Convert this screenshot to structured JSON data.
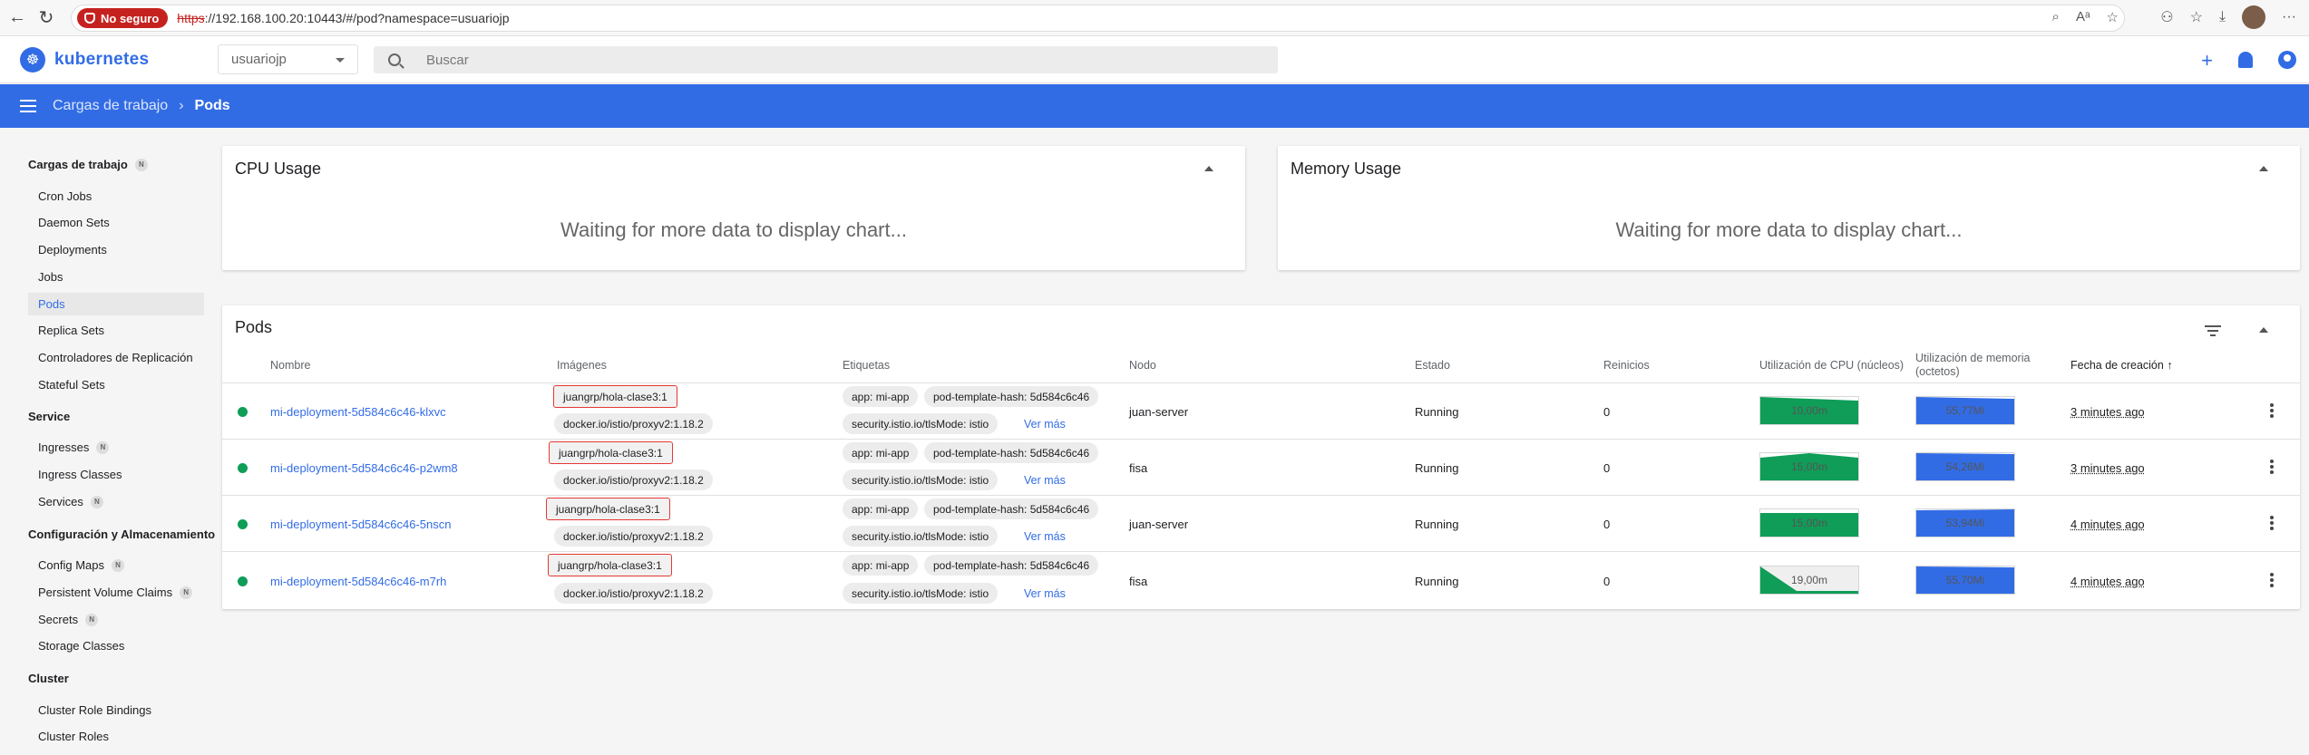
{
  "browser": {
    "insecure_label": "No seguro",
    "url_proto": "https",
    "url_rest": "://192.168.100.20:10443/#/pod?namespace=usuariojp"
  },
  "header": {
    "logo_text": "kubernetes",
    "namespace": "usuariojp",
    "search_placeholder": "Buscar"
  },
  "toolbar": {
    "crumb_parent": "Cargas de trabajo",
    "crumb_current": "Pods"
  },
  "sidebar": {
    "sections": [
      {
        "label": "Cargas de trabajo",
        "badge": "N"
      },
      {
        "label": "Service"
      },
      {
        "label": "Configuración y Almacenamiento"
      },
      {
        "label": "Cluster"
      }
    ],
    "items": [
      {
        "label": "Cron Jobs"
      },
      {
        "label": "Daemon Sets"
      },
      {
        "label": "Deployments"
      },
      {
        "label": "Jobs"
      },
      {
        "label": "Pods",
        "active": true
      },
      {
        "label": "Replica Sets"
      },
      {
        "label": "Controladores de Replicación"
      },
      {
        "label": "Stateful Sets"
      },
      {
        "label": "Ingresses",
        "badge": "N"
      },
      {
        "label": "Ingress Classes"
      },
      {
        "label": "Services",
        "badge": "N"
      },
      {
        "label": "Config Maps",
        "badge": "N"
      },
      {
        "label": "Persistent Volume Claims",
        "badge": "N"
      },
      {
        "label": "Secrets",
        "badge": "N"
      },
      {
        "label": "Storage Classes"
      },
      {
        "label": "Cluster Role Bindings"
      },
      {
        "label": "Cluster Roles"
      }
    ]
  },
  "cards": {
    "cpu_title": "CPU Usage",
    "memory_title": "Memory Usage",
    "waiting": "Waiting for more data to display chart..."
  },
  "pods": {
    "title": "Pods",
    "columns": {
      "name": "Nombre",
      "images": "Imágenes",
      "labels": "Etiquetas",
      "node": "Nodo",
      "status": "Estado",
      "restarts": "Reinicios",
      "cpu": "Utilización de CPU (núcleos)",
      "memory_line1": "Utilización de memoria",
      "memory_line2": "(octetos)",
      "created": "Fecha de creación",
      "sort_arrow": "↑"
    },
    "ver_mas": "Ver más",
    "rows": [
      {
        "name": "mi-deployment-5d584c6c46-klxvc",
        "image1": "juangrp/hola-clase3:1",
        "image2": "docker.io/istio/proxyv2:1.18.2",
        "label1": "app: mi-app",
        "label2": "pod-template-hash: 5d584c6c46",
        "label3": "security.istio.io/tlsMode: istio",
        "node": "juan-server",
        "status": "Running",
        "restarts": "0",
        "cpu": "10,00m",
        "memory": "55,77Mi",
        "created": "3 minutes ago"
      },
      {
        "name": "mi-deployment-5d584c6c46-p2wm8",
        "image1": "juangrp/hola-clase3:1",
        "image2": "docker.io/istio/proxyv2:1.18.2",
        "label1": "app: mi-app",
        "label2": "pod-template-hash: 5d584c6c46",
        "label3": "security.istio.io/tlsMode: istio",
        "node": "fisa",
        "status": "Running",
        "restarts": "0",
        "cpu": "15,00m",
        "memory": "54,26Mi",
        "created": "3 minutes ago"
      },
      {
        "name": "mi-deployment-5d584c6c46-5nscn",
        "image1": "juangrp/hola-clase3:1",
        "image2": "docker.io/istio/proxyv2:1.18.2",
        "label1": "app: mi-app",
        "label2": "pod-template-hash: 5d584c6c46",
        "label3": "security.istio.io/tlsMode: istio",
        "node": "juan-server",
        "status": "Running",
        "restarts": "0",
        "cpu": "15,00m",
        "memory": "53,94Mi",
        "created": "4 minutes ago"
      },
      {
        "name": "mi-deployment-5d584c6c46-m7rh",
        "image1": "juangrp/hola-clase3:1",
        "image2": "docker.io/istio/proxyv2:1.18.2",
        "label1": "app: mi-app",
        "label2": "pod-template-hash: 5d584c6c46",
        "label3": "security.istio.io/tlsMode: istio",
        "node": "fisa",
        "status": "Running",
        "restarts": "0",
        "cpu": "19,00m",
        "memory": "55,70Mi",
        "created": "4 minutes ago"
      }
    ]
  },
  "colors": {
    "accent": "#326ce5",
    "running": "#0f9d58",
    "cpu_fill": "#0f9d58",
    "mem_fill": "#326ce5"
  }
}
